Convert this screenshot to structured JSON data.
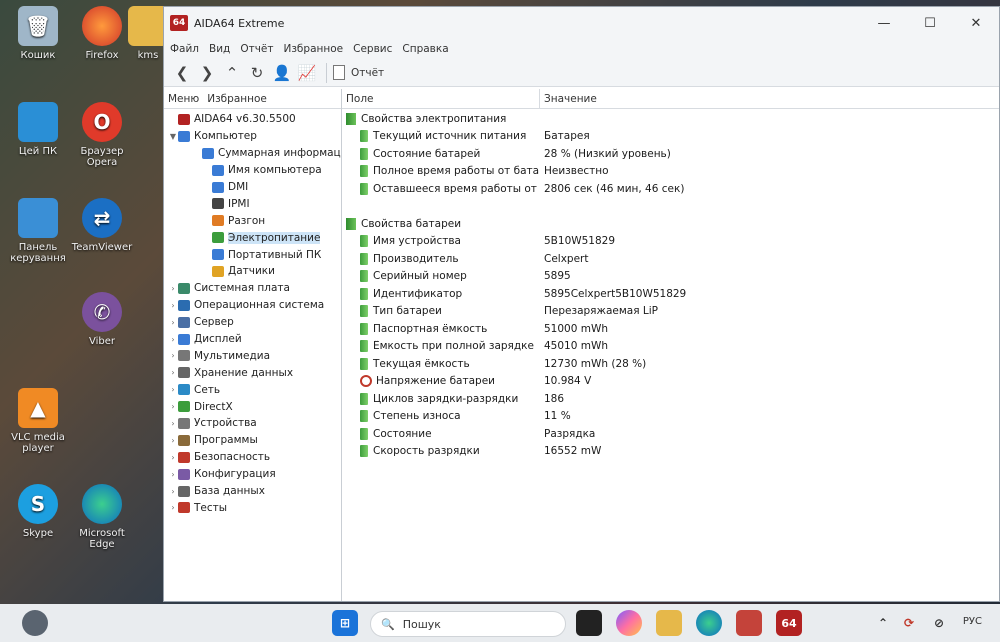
{
  "desktop": {
    "icons": [
      {
        "label": "Кошик"
      },
      {
        "label": "Firefox"
      },
      {
        "label": "kms"
      },
      {
        "label": "Цей ПК"
      },
      {
        "label": "Браузер Opera"
      },
      {
        "label": "Панель керування"
      },
      {
        "label": "TeamViewer"
      },
      {
        "label": "Viber"
      },
      {
        "label": "VLC media player"
      },
      {
        "label": "Skype"
      },
      {
        "label": "Microsoft Edge"
      }
    ]
  },
  "window": {
    "badge": "64",
    "title": "AIDA64 Extreme",
    "controls": {
      "minimize": "—",
      "maximize": "☐",
      "close": "✕"
    }
  },
  "menu": [
    "Файл",
    "Вид",
    "Отчёт",
    "Избранное",
    "Сервис",
    "Справка"
  ],
  "toolbar": {
    "report_label": "Отчёт"
  },
  "left_pane": {
    "tabs": [
      "Меню",
      "Избранное"
    ],
    "tree": [
      {
        "label": "AIDA64 v6.30.5500",
        "level": 0,
        "color": "#b22222",
        "arrow": ""
      },
      {
        "label": "Компьютер",
        "level": 0,
        "color": "#3a7bd5",
        "arrow": "▼"
      },
      {
        "label": "Суммарная информация",
        "level": 1,
        "color": "#3a7bd5",
        "arrow": ""
      },
      {
        "label": "Имя компьютера",
        "level": 1,
        "color": "#3a7bd5",
        "arrow": ""
      },
      {
        "label": "DMI",
        "level": 1,
        "color": "#3a7bd5",
        "arrow": ""
      },
      {
        "label": "IPMI",
        "level": 1,
        "color": "#444444",
        "arrow": ""
      },
      {
        "label": "Разгон",
        "level": 1,
        "color": "#e07b24",
        "arrow": ""
      },
      {
        "label": "Электропитание",
        "level": 1,
        "color": "#3c9d3c",
        "arrow": "",
        "selected": true
      },
      {
        "label": "Портативный ПК",
        "level": 1,
        "color": "#3a7bd5",
        "arrow": ""
      },
      {
        "label": "Датчики",
        "level": 1,
        "color": "#e0a324",
        "arrow": ""
      },
      {
        "label": "Системная плата",
        "level": 0,
        "color": "#3a8a6a",
        "arrow": "›"
      },
      {
        "label": "Операционная система",
        "level": 0,
        "color": "#2b6cb0",
        "arrow": "›"
      },
      {
        "label": "Сервер",
        "level": 0,
        "color": "#4a6fa5",
        "arrow": "›"
      },
      {
        "label": "Дисплей",
        "level": 0,
        "color": "#3a7bd5",
        "arrow": "›"
      },
      {
        "label": "Мультимедиа",
        "level": 0,
        "color": "#777777",
        "arrow": "›"
      },
      {
        "label": "Хранение данных",
        "level": 0,
        "color": "#666666",
        "arrow": "›"
      },
      {
        "label": "Сеть",
        "level": 0,
        "color": "#2b8ac6",
        "arrow": "›"
      },
      {
        "label": "DirectX",
        "level": 0,
        "color": "#3c9d3c",
        "arrow": "›"
      },
      {
        "label": "Устройства",
        "level": 0,
        "color": "#777777",
        "arrow": "›"
      },
      {
        "label": "Программы",
        "level": 0,
        "color": "#8a6a3a",
        "arrow": "›"
      },
      {
        "label": "Безопасность",
        "level": 0,
        "color": "#c0392b",
        "arrow": "›"
      },
      {
        "label": "Конфигурация",
        "level": 0,
        "color": "#7a5aa5",
        "arrow": "›"
      },
      {
        "label": "База данных",
        "level": 0,
        "color": "#666666",
        "arrow": "›"
      },
      {
        "label": "Тесты",
        "level": 0,
        "color": "#c0392b",
        "arrow": "›"
      }
    ]
  },
  "right_pane": {
    "columns": [
      "Поле",
      "Значение"
    ],
    "sections": [
      {
        "title": "Свойства электропитания",
        "rows": [
          {
            "field": "Текущий источник питания",
            "value": "Батарея"
          },
          {
            "field": "Состояние батарей",
            "value": "28 % (Низкий уровень)"
          },
          {
            "field": "Полное время работы от батар...",
            "value": "Неизвестно"
          },
          {
            "field": "Оставшееся время работы от б...",
            "value": "2806 сек (46 мин, 46 сек)"
          }
        ]
      },
      {
        "title": "Свойства батареи",
        "rows": [
          {
            "field": "Имя устройства",
            "value": "5B10W51829"
          },
          {
            "field": "Производитель",
            "value": "Celxpert"
          },
          {
            "field": "Серийный номер",
            "value": "5895"
          },
          {
            "field": "Идентификатор",
            "value": "5895Celxpert5B10W51829"
          },
          {
            "field": "Тип батареи",
            "value": "Перезаряжаемая LiP"
          },
          {
            "field": "Паспортная ёмкость",
            "value": "51000 mWh"
          },
          {
            "field": "Ёмкость при полной зарядке",
            "value": "45010 mWh"
          },
          {
            "field": "Текущая ёмкость",
            "value": "12730 mWh  (28 %)"
          },
          {
            "field": "Напряжение батареи",
            "value": "10.984 V",
            "icon": "voltage-icon"
          },
          {
            "field": "Циклов зарядки-разрядки",
            "value": "186"
          },
          {
            "field": "Степень износа",
            "value": "11 %"
          },
          {
            "field": "Состояние",
            "value": "Разрядка"
          },
          {
            "field": "Скорость разрядки",
            "value": "16552 mW"
          }
        ]
      }
    ]
  },
  "taskbar": {
    "search_placeholder": "Пошук",
    "lang": "РУС",
    "aida_badge": "64"
  }
}
